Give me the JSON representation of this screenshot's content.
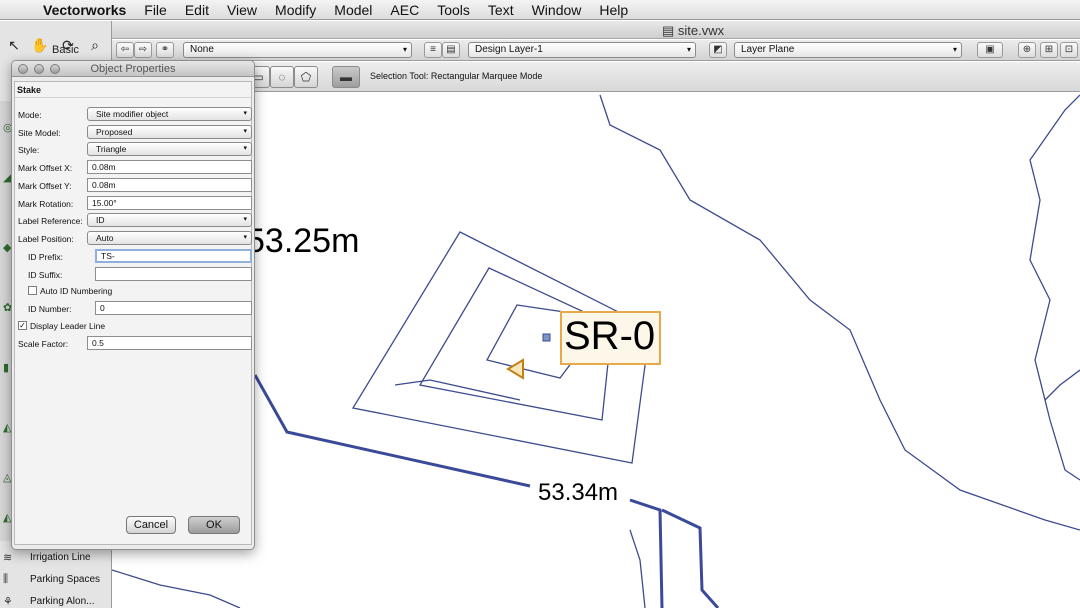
{
  "menubar": {
    "app": "Vectorworks",
    "items": [
      "File",
      "Edit",
      "View",
      "Modify",
      "Model",
      "AEC",
      "Tools",
      "Text",
      "Window",
      "Help"
    ]
  },
  "document": {
    "title": "site.vwx"
  },
  "palette": {
    "title": "Basic"
  },
  "viewbar": {
    "class_select": "None",
    "layer_select": "Design Layer-1",
    "plane_select": "Layer Plane"
  },
  "modebar": {
    "status": "Selection Tool: Rectangular Marquee Mode"
  },
  "tool_list": [
    {
      "label": "Irrigation Line",
      "icon": "irrigation-line-icon"
    },
    {
      "label": "Parking Spaces",
      "icon": "parking-spaces-icon"
    },
    {
      "label": "Parking Alon...",
      "icon": "parking-along-icon"
    }
  ],
  "canvas": {
    "labels": [
      "53.25m",
      "53.34m"
    ],
    "stake_label": "SR-0",
    "accent": "#e8a94a",
    "contour_color": "#3a4a94"
  },
  "dialog": {
    "title": "Object Properties",
    "object_type": "Stake",
    "fields": {
      "mode": {
        "label": "Mode:",
        "value": "Site modifier object"
      },
      "site_model": {
        "label": "Site Model:",
        "value": "Proposed"
      },
      "style": {
        "label": "Style:",
        "value": "Triangle"
      },
      "mark_offset_x": {
        "label": "Mark Offset X:",
        "value": "0.08m"
      },
      "mark_offset_y": {
        "label": "Mark Offset Y:",
        "value": "0.08m"
      },
      "mark_rotation": {
        "label": "Mark Rotation:",
        "value": "15.00°"
      },
      "label_reference": {
        "label": "Label Reference:",
        "value": "ID"
      },
      "label_position": {
        "label": "Label Position:",
        "value": "Auto"
      },
      "id_prefix": {
        "label": "ID Prefix:",
        "value": "TS-"
      },
      "id_suffix": {
        "label": "ID Suffix:",
        "value": ""
      },
      "auto_id": {
        "label": "Auto ID Numbering",
        "checked": false
      },
      "id_number": {
        "label": "ID Number:",
        "value": "0"
      },
      "display_leader": {
        "label": "Display Leader Line",
        "checked": true
      },
      "scale_factor": {
        "label": "Scale Factor:",
        "value": "0.5"
      }
    },
    "cancel": "Cancel",
    "ok": "OK"
  }
}
